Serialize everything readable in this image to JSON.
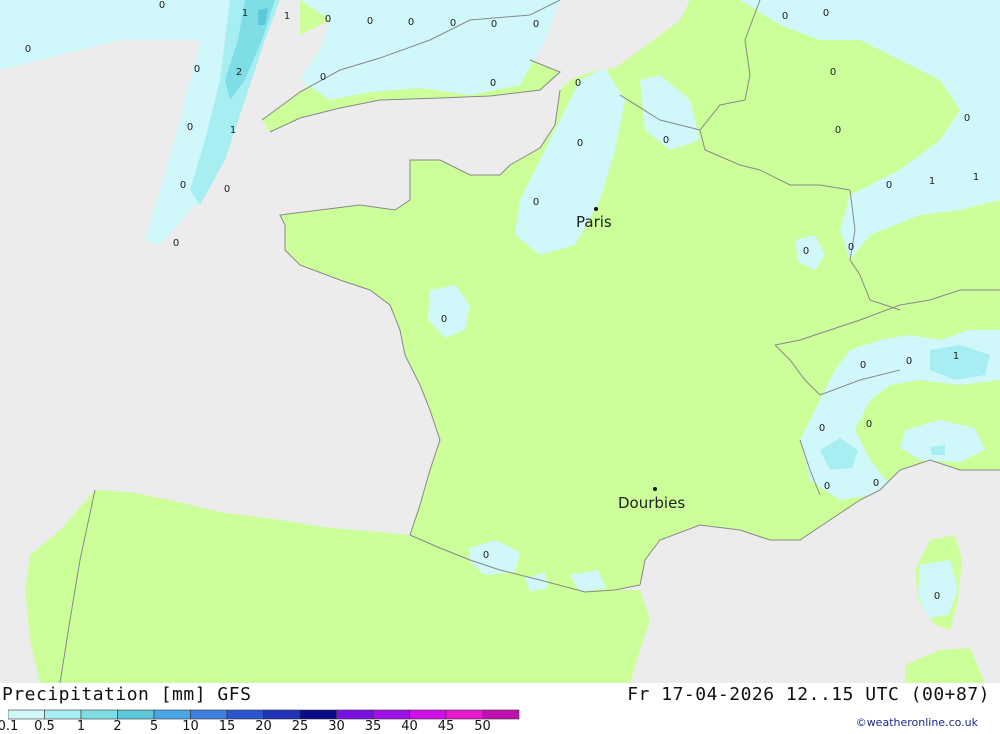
{
  "map": {
    "colors": {
      "sea": "#ececec",
      "land": "#ccff99",
      "precip_trace": "#d0f7fa",
      "precip_light": "#a7eef3",
      "precip_mod": "#7fdde6",
      "precip_heavy": "#5cc8d9",
      "border": "#888888"
    },
    "cities": [
      {
        "name": "Paris"
      },
      {
        "name": "Dourbies"
      }
    ],
    "contour_labels": [
      "0",
      "0",
      "1",
      "1",
      "0",
      "0",
      "0",
      "0",
      "0",
      "0",
      "0",
      "0",
      "2",
      "0",
      "1",
      "0",
      "0",
      "0",
      "0",
      "0",
      "0",
      "0",
      "0",
      "0",
      "0",
      "0",
      "0",
      "1",
      "1",
      "0",
      "0",
      "0",
      "0",
      "1",
      "0",
      "0",
      "0",
      "0",
      "0",
      "0",
      "0",
      "0",
      "0"
    ]
  },
  "footer": {
    "title_left": "Precipitation [mm] GFS",
    "title_right": "Fr 17-04-2026 12..15 UTC (00+87)",
    "credit": "©weatheronline.co.uk",
    "colorbar": {
      "labels": [
        "0.1",
        "0.5",
        "1",
        "2",
        "5",
        "10",
        "15",
        "20",
        "25",
        "30",
        "35",
        "40",
        "45",
        "50"
      ],
      "colors": [
        "#d0f7fa",
        "#a7eef3",
        "#7fdde6",
        "#5cc8d9",
        "#4aa6e6",
        "#3d80e0",
        "#2d55d0",
        "#1f32b8",
        "#0a0a8a",
        "#7a10e0",
        "#a010e8",
        "#d010e8",
        "#e81ad0",
        "#c010b0"
      ]
    }
  }
}
